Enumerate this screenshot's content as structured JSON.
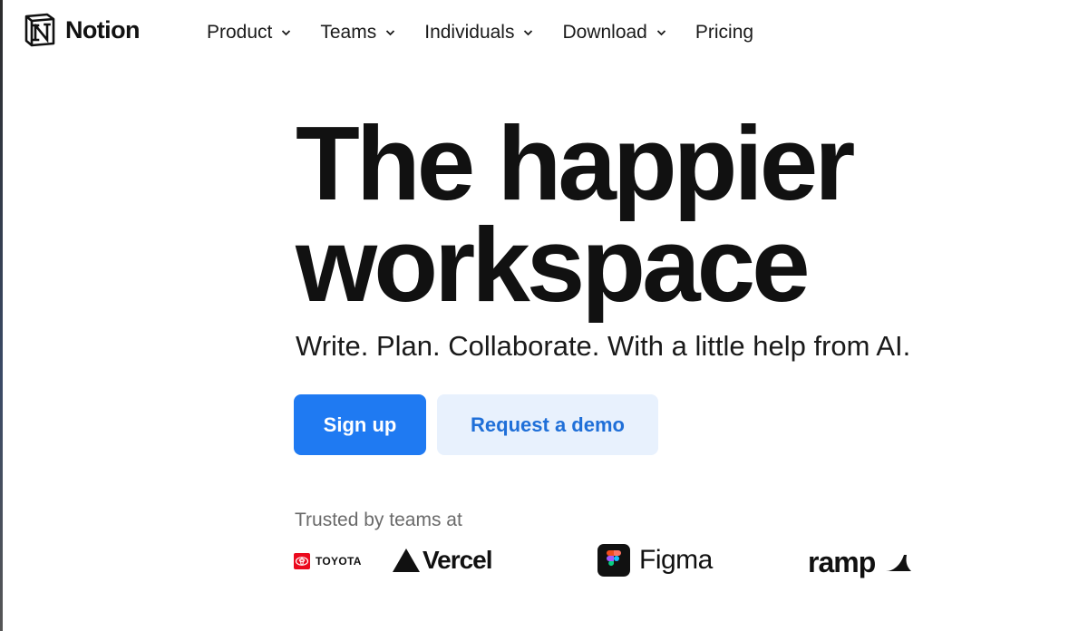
{
  "brand": {
    "name": "Notion"
  },
  "nav": {
    "items": [
      {
        "label": "Product",
        "has_dropdown": true
      },
      {
        "label": "Teams",
        "has_dropdown": true
      },
      {
        "label": "Individuals",
        "has_dropdown": true
      },
      {
        "label": "Download",
        "has_dropdown": true
      },
      {
        "label": "Pricing",
        "has_dropdown": false
      }
    ]
  },
  "hero": {
    "title_line1": "The happier",
    "title_line2": "workspace",
    "subtitle": "Write. Plan. Collaborate. With a little help from AI."
  },
  "cta": {
    "primary_label": "Sign up",
    "secondary_label": "Request a demo"
  },
  "trusted": {
    "label": "Trusted by teams at",
    "logos": [
      {
        "name": "TOYOTA",
        "icon": "toyota-logo-icon"
      },
      {
        "name": "Vercel",
        "icon": "vercel-triangle-icon"
      },
      {
        "name": "Figma",
        "icon": "figma-logo-icon"
      },
      {
        "name": "ramp",
        "icon": "ramp-logo-icon"
      }
    ]
  },
  "colors": {
    "primary": "#1f7af2",
    "secondary_bg": "#e8f1fd",
    "secondary_text": "#1f6fd8",
    "text": "#111111",
    "muted_text": "#6a6a6a",
    "toyota_red": "#eb0a1e"
  }
}
